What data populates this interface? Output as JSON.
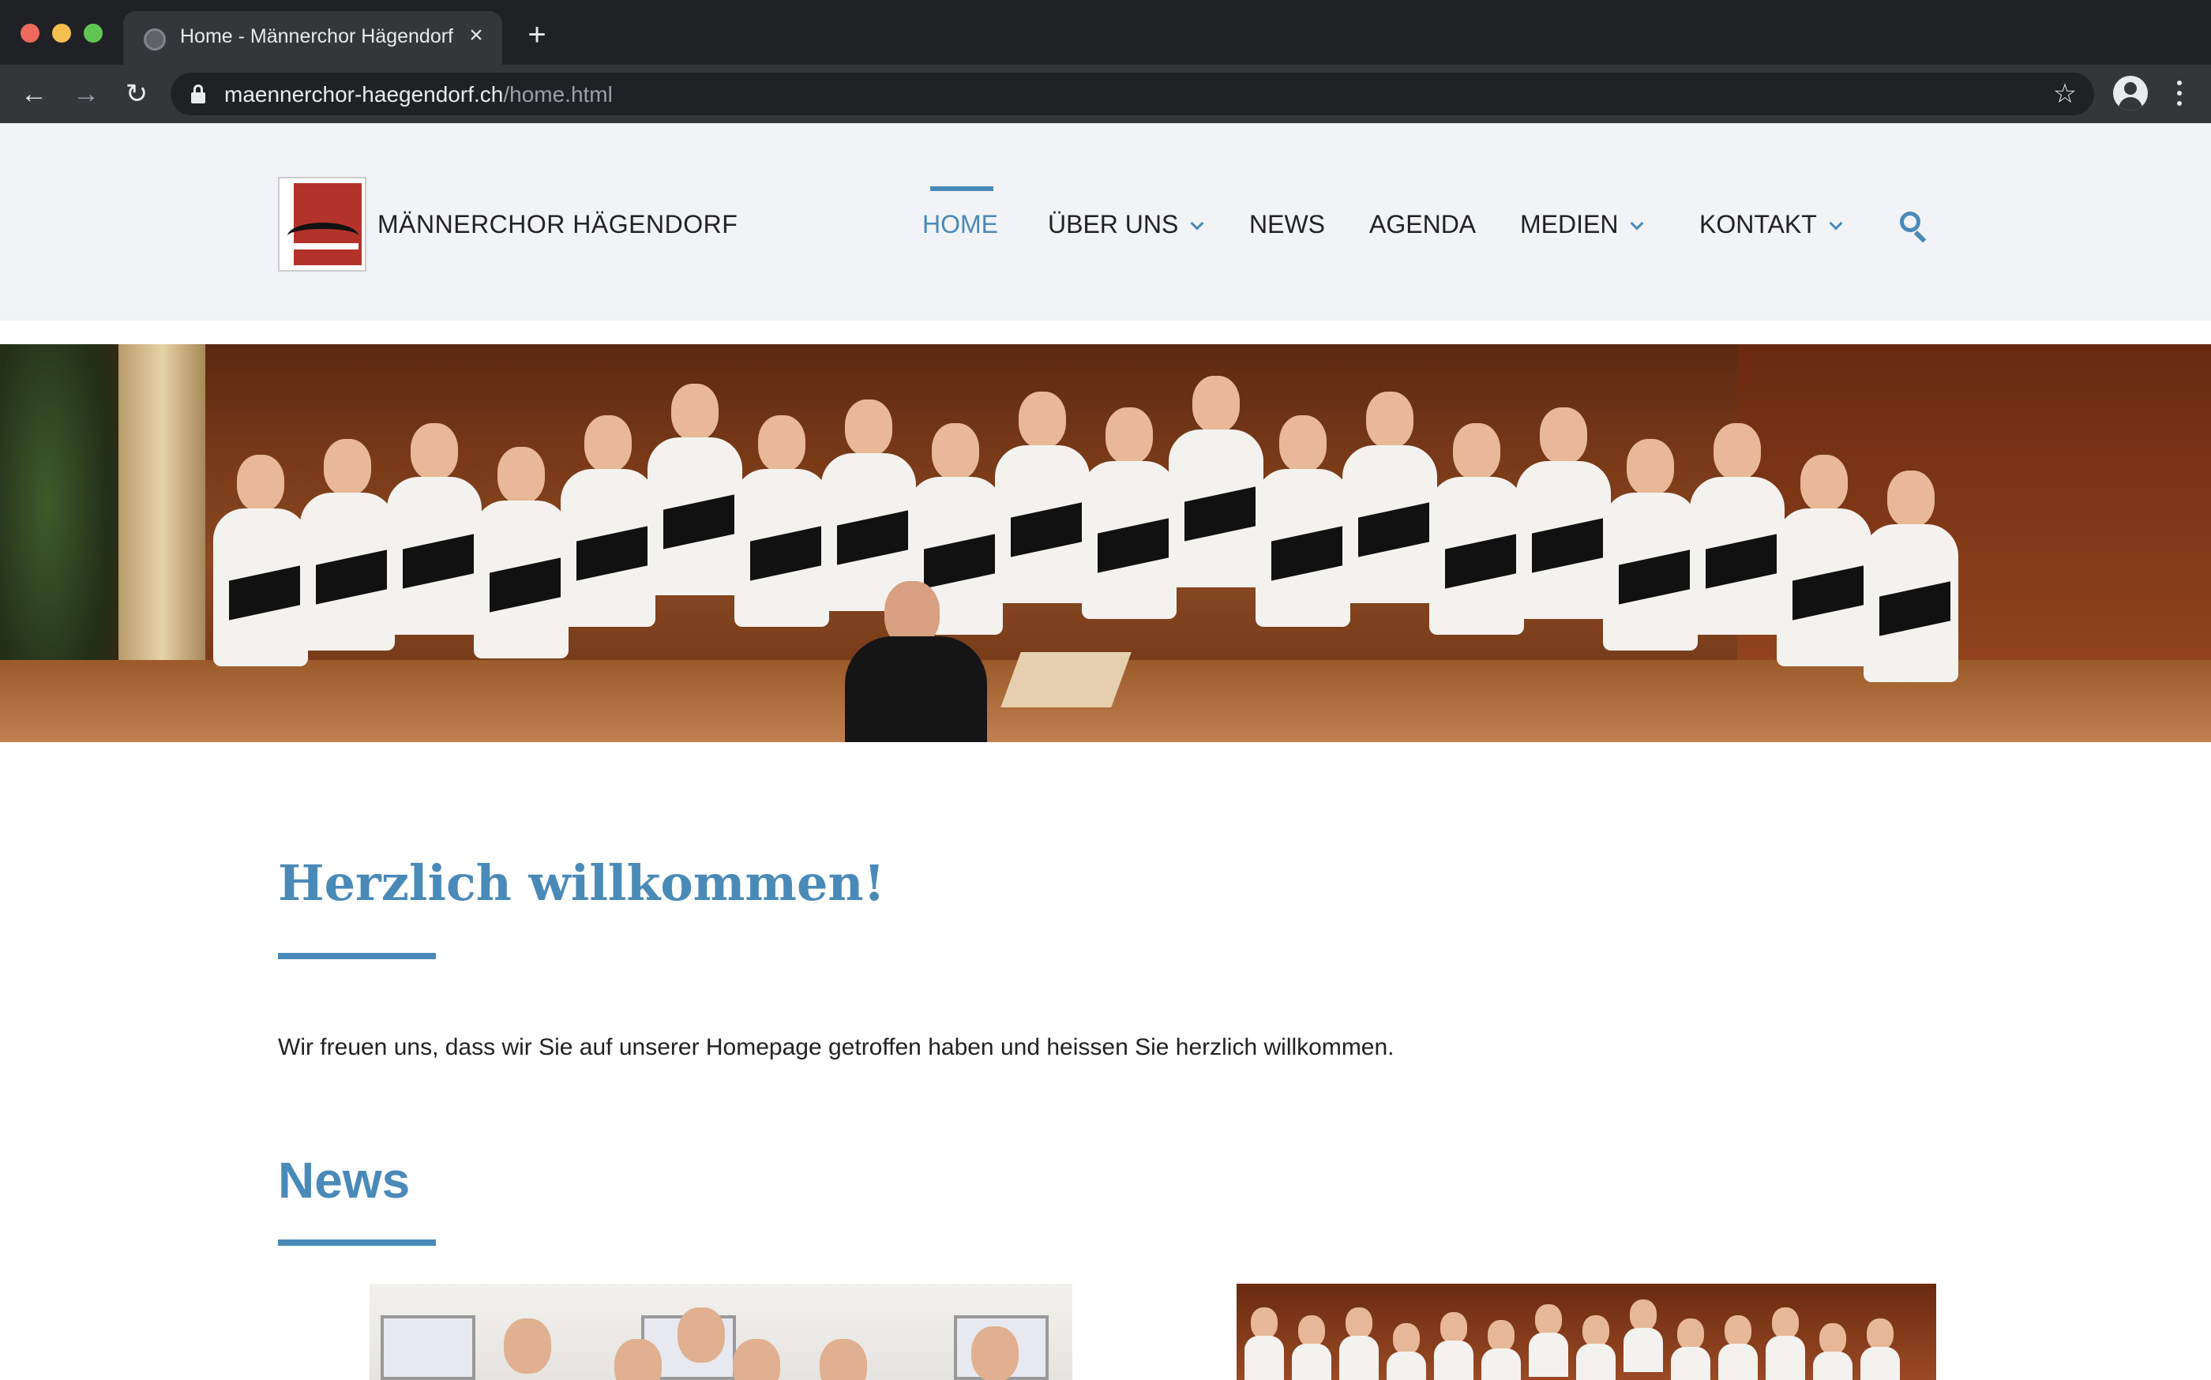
{
  "browser": {
    "tab_title": "Home - Männerchor Hägendorf",
    "url_domain": "maennerchor-haegendorf.ch",
    "url_path": "/home.html"
  },
  "site": {
    "name": "MÄNNERCHOR HÄGENDORF",
    "accent_color": "#4a8ab8",
    "nav": [
      {
        "label": "HOME",
        "active": true,
        "dropdown": false
      },
      {
        "label": "ÜBER UNS",
        "active": false,
        "dropdown": true
      },
      {
        "label": "NEWS",
        "active": false,
        "dropdown": false
      },
      {
        "label": "AGENDA",
        "active": false,
        "dropdown": false
      },
      {
        "label": "MEDIEN",
        "active": false,
        "dropdown": true
      },
      {
        "label": "KONTAKT",
        "active": false,
        "dropdown": true
      }
    ]
  },
  "content": {
    "welcome_title": "Herzlich willkommen!",
    "intro_text": "Wir freuen uns, dass wir Sie auf unserer Homepage getroffen haben und heissen Sie herzlich willkommen.",
    "news_heading": "News"
  },
  "icons": {
    "search": "search-icon",
    "star": "star-icon",
    "profile": "profile-icon",
    "menu": "menu-icon"
  }
}
